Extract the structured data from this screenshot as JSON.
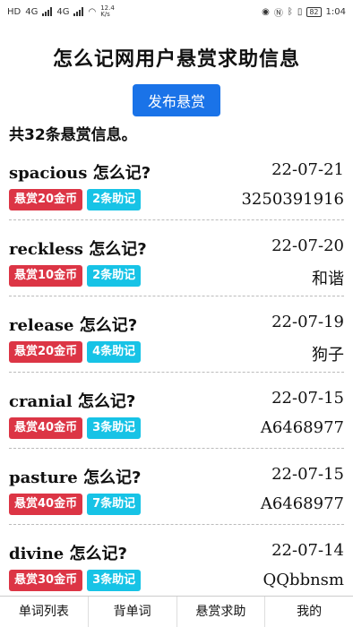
{
  "status_bar": {
    "left_labels": [
      "HD",
      "4G",
      "4G",
      "12.4",
      "K/s"
    ],
    "battery": "82",
    "time": "1:04"
  },
  "page": {
    "title": "怎么记网用户悬赏求助信息",
    "publish_label": "发布悬赏",
    "count_text": "共32条悬赏信息。"
  },
  "items": [
    {
      "word": "spacious",
      "suffix": " 怎么记?",
      "date": "22-07-21",
      "reward": "悬赏20金币",
      "helps": "2条助记",
      "user": "3250391916"
    },
    {
      "word": "reckless",
      "suffix": " 怎么记?",
      "date": "22-07-20",
      "reward": "悬赏10金币",
      "helps": "2条助记",
      "user": "和谐"
    },
    {
      "word": "release",
      "suffix": " 怎么记?",
      "date": "22-07-19",
      "reward": "悬赏20金币",
      "helps": "4条助记",
      "user": "狗子"
    },
    {
      "word": "cranial",
      "suffix": " 怎么记?",
      "date": "22-07-15",
      "reward": "悬赏40金币",
      "helps": "3条助记",
      "user": "A6468977"
    },
    {
      "word": "pasture",
      "suffix": " 怎么记?",
      "date": "22-07-15",
      "reward": "悬赏40金币",
      "helps": "7条助记",
      "user": "A6468977"
    },
    {
      "word": "divine",
      "suffix": " 怎么记?",
      "date": "22-07-14",
      "reward": "悬赏30金币",
      "helps": "3条助记",
      "user": "QQbbnsm"
    }
  ],
  "nav": [
    "单词列表",
    "背单词",
    "悬赏求助",
    "我的"
  ],
  "colors": {
    "primary": "#1a73e8",
    "reward_badge": "#dc3545",
    "help_badge": "#17c3e6"
  }
}
